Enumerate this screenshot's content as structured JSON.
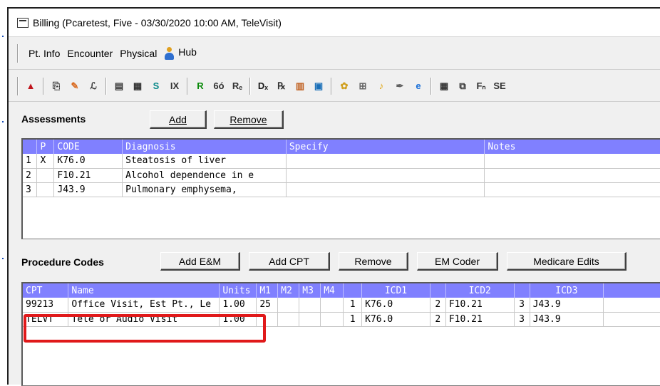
{
  "window": {
    "title": "Billing (Pcaretest, Five - 03/30/2020  10:00 AM, TeleVisit)"
  },
  "menu": {
    "items": [
      "Pt. Info",
      "Encounter",
      "Physical",
      "Hub"
    ]
  },
  "toolbar": {
    "icons": [
      {
        "name": "alert-icon",
        "glyph": "▲",
        "color": "#c0141c"
      },
      {
        "name": "copy-icon",
        "glyph": "⎘",
        "color": "#333333"
      },
      {
        "name": "eraser-icon",
        "glyph": "✎",
        "color": "#d96a20"
      },
      {
        "name": "signature-icon",
        "glyph": "ℒ",
        "color": "#333333"
      },
      {
        "name": "form-icon",
        "glyph": "▤",
        "color": "#333333"
      },
      {
        "name": "calendar-icon",
        "glyph": "▦",
        "color": "#333333"
      },
      {
        "name": "s-icon",
        "glyph": "S",
        "color": "#0a8a8a"
      },
      {
        "name": "ix-icon",
        "glyph": "IX",
        "color": "#333333"
      },
      {
        "name": "r-icon",
        "glyph": "R",
        "color": "#0a8a0a"
      },
      {
        "name": "glasses-icon",
        "glyph": "6ó",
        "color": "#333333"
      },
      {
        "name": "re-icon",
        "glyph": "Rₑ",
        "color": "#333333"
      },
      {
        "name": "dx-icon",
        "glyph": "Dₓ",
        "color": "#1a1a1a"
      },
      {
        "name": "rx-icon",
        "glyph": "℞",
        "color": "#333333"
      },
      {
        "name": "table-icon",
        "glyph": "▥",
        "color": "#c06020"
      },
      {
        "name": "monitor-icon",
        "glyph": "▣",
        "color": "#1a6fb8"
      },
      {
        "name": "lungs-icon",
        "glyph": "✿",
        "color": "#d0a020"
      },
      {
        "name": "robot-icon",
        "glyph": "⊞",
        "color": "#666666"
      },
      {
        "name": "bell-icon",
        "glyph": "♪",
        "color": "#e0a000"
      },
      {
        "name": "syringe-icon",
        "glyph": "✒",
        "color": "#606060"
      },
      {
        "name": "ie-icon",
        "glyph": "e",
        "color": "#1a6fd8"
      },
      {
        "name": "notes-icon",
        "glyph": "▦",
        "color": "#333333"
      },
      {
        "name": "merge-icon",
        "glyph": "⧉",
        "color": "#333333"
      },
      {
        "name": "fn-icon",
        "glyph": "Fₙ",
        "color": "#333333"
      },
      {
        "name": "se-icon",
        "glyph": "SE",
        "color": "#333333"
      }
    ]
  },
  "assessments": {
    "label": "Assessments",
    "add_label": "Add",
    "remove_label": "Remove",
    "columns": [
      "",
      "P",
      "CODE",
      "Diagnosis",
      "Specify",
      "Notes"
    ],
    "rows": [
      {
        "num": "1",
        "p": "X",
        "code": "K76.0",
        "diagnosis": "Steatosis of liver",
        "specify": "",
        "notes": ""
      },
      {
        "num": "2",
        "p": "",
        "code": "F10.21",
        "diagnosis": "Alcohol dependence in e",
        "specify": "",
        "notes": ""
      },
      {
        "num": "3",
        "p": "",
        "code": "J43.9",
        "diagnosis": "Pulmonary emphysema,",
        "specify": "",
        "notes": ""
      }
    ]
  },
  "procedures": {
    "label": "Procedure Codes",
    "buttons": {
      "add_em": "Add E&M",
      "add_cpt": "Add CPT",
      "remove": "Remove",
      "em_coder": "EM Coder",
      "medicare_edits": "Medicare Edits"
    },
    "columns": [
      "CPT",
      "Name",
      "Units",
      "M1",
      "M2",
      "M3",
      "M4",
      "",
      "ICD1",
      "",
      "ICD2",
      "",
      "ICD3",
      ""
    ],
    "rows": [
      {
        "cpt": "99213",
        "name": "Office Visit, Est Pt., Le",
        "units": "1.00",
        "m1": "25",
        "m2": "",
        "m3": "",
        "m4": "",
        "n1": "1",
        "icd1": "K76.0",
        "n2": "2",
        "icd2": "F10.21",
        "n3": "3",
        "icd3": "J43.9"
      },
      {
        "cpt": "TELVT",
        "name": "Tele or Audio Visit",
        "units": "1.00",
        "m1": "",
        "m2": "",
        "m3": "",
        "m4": "",
        "n1": "1",
        "icd1": "K76.0",
        "n2": "2",
        "icd2": "F10.21",
        "n3": "3",
        "icd3": "J43.9"
      }
    ]
  },
  "colors": {
    "header_bg": "#8080ff",
    "highlight": "#e0191a"
  }
}
